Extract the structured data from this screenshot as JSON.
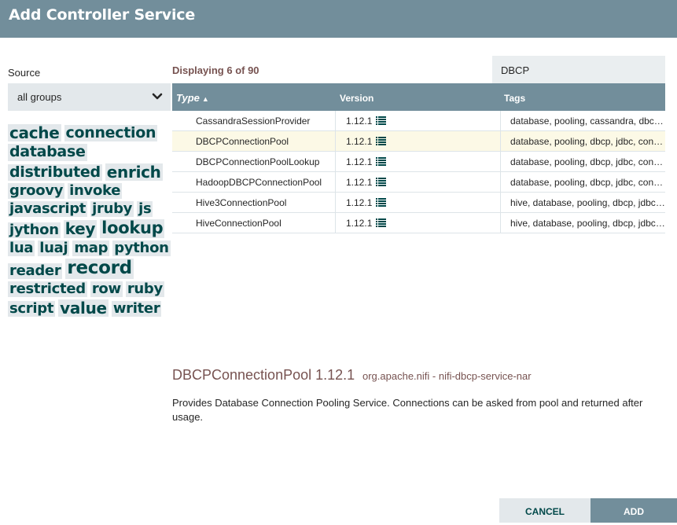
{
  "dialog": {
    "title": "Add Controller Service"
  },
  "source": {
    "label": "Source",
    "selected": "all groups"
  },
  "tags": [
    {
      "label": "cache",
      "size": 20
    },
    {
      "label": "connection",
      "size": 19
    },
    {
      "label": "database",
      "size": 19
    },
    {
      "label": "distributed",
      "size": 19
    },
    {
      "label": "enrich",
      "size": 20
    },
    {
      "label": "groovy",
      "size": 18
    },
    {
      "label": "invoke",
      "size": 18
    },
    {
      "label": "javascript",
      "size": 18
    },
    {
      "label": "jruby",
      "size": 18
    },
    {
      "label": "js",
      "size": 18
    },
    {
      "label": "jython",
      "size": 18
    },
    {
      "label": "key",
      "size": 20
    },
    {
      "label": "lookup",
      "size": 21
    },
    {
      "label": "lua",
      "size": 18
    },
    {
      "label": "luaj",
      "size": 18
    },
    {
      "label": "map",
      "size": 18
    },
    {
      "label": "python",
      "size": 18
    },
    {
      "label": "reader",
      "size": 18
    },
    {
      "label": "record",
      "size": 23
    },
    {
      "label": "restricted",
      "size": 18
    },
    {
      "label": "row",
      "size": 18
    },
    {
      "label": "ruby",
      "size": 18
    },
    {
      "label": "script",
      "size": 18
    },
    {
      "label": "value",
      "size": 20
    },
    {
      "label": "writer",
      "size": 18
    }
  ],
  "results": {
    "displaying": "Displaying 6 of 90",
    "filter_value": "DBCP"
  },
  "grid": {
    "columns": {
      "type": "Type",
      "version": "Version",
      "tags": "Tags"
    },
    "rows": [
      {
        "type": "CassandraSessionProvider",
        "version": "1.12.1",
        "tags": "database, pooling, cassandra, dbcp, connection",
        "selected": false
      },
      {
        "type": "DBCPConnectionPool",
        "version": "1.12.1",
        "tags": "database, pooling, dbcp, jdbc, connection, store",
        "selected": true
      },
      {
        "type": "DBCPConnectionPoolLookup",
        "version": "1.12.1",
        "tags": "database, pooling, dbcp, jdbc, connection",
        "selected": false
      },
      {
        "type": "HadoopDBCPConnectionPool",
        "version": "1.12.1",
        "tags": "database, pooling, dbcp, jdbc, connection",
        "selected": false
      },
      {
        "type": "Hive3ConnectionPool",
        "version": "1.12.1",
        "tags": "hive, database, pooling, dbcp, jdbc, connection",
        "selected": false
      },
      {
        "type": "HiveConnectionPool",
        "version": "1.12.1",
        "tags": "hive, database, pooling, dbcp, jdbc, connection",
        "selected": false
      }
    ]
  },
  "details": {
    "title": "DBCPConnectionPool 1.12.1",
    "bundle": "org.apache.nifi - nifi-dbcp-service-nar",
    "description": "Provides Database Connection Pooling Service. Connections can be asked from pool and returned after usage."
  },
  "buttons": {
    "cancel": "CANCEL",
    "add": "ADD"
  },
  "colors": {
    "header": "#728e9b",
    "tag_text": "#004849",
    "accent_brown": "#775351",
    "selected_row": "#fcf9e6"
  },
  "icons": {
    "source_dropdown": "chevron-down-icon",
    "version_info": "list-icon",
    "sort": "sort-asc-icon"
  }
}
